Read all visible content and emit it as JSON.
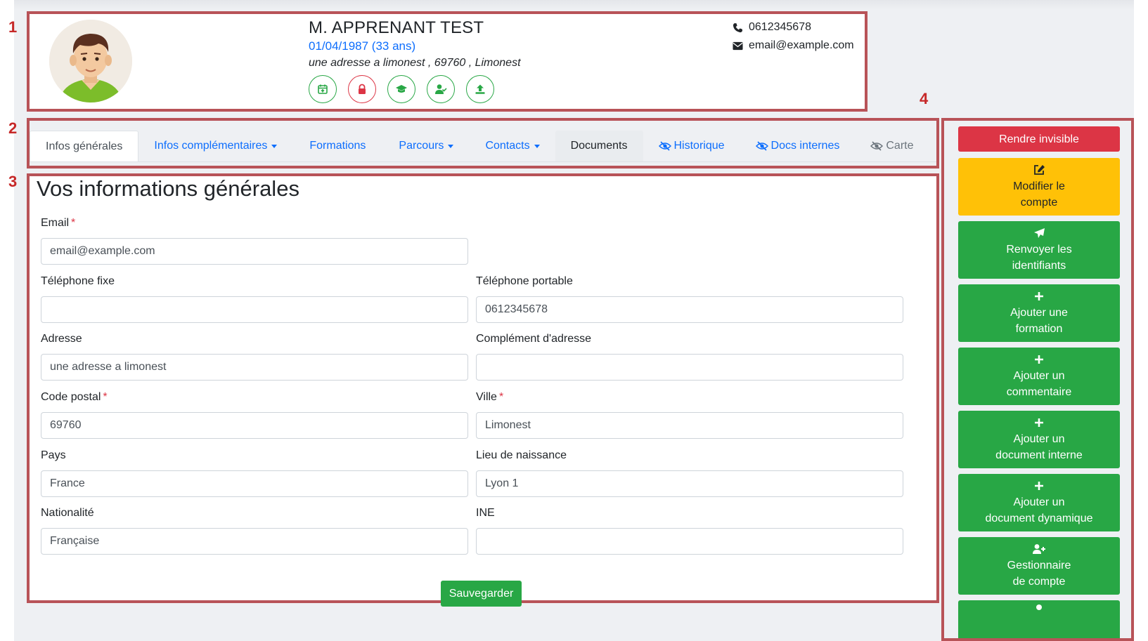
{
  "markers": [
    "1",
    "2",
    "3",
    "4"
  ],
  "header": {
    "name": "M. APPRENANT TEST",
    "dob": "01/04/1987 (33 ans)",
    "address": "une adresse a limonest , 69760 , Limonest",
    "phone": "0612345678",
    "email": "email@example.com",
    "icons": [
      "calendar-plus-icon",
      "lock-icon",
      "graduation-cap-icon",
      "user-check-icon",
      "upload-icon"
    ]
  },
  "tabs": [
    {
      "label": "Infos générales",
      "state": "active"
    },
    {
      "label": "Infos complémentaires",
      "dropdown": true
    },
    {
      "label": "Formations"
    },
    {
      "label": "Parcours",
      "dropdown": true
    },
    {
      "label": "Contacts",
      "dropdown": true
    },
    {
      "label": "Documents",
      "state": "dark"
    },
    {
      "label": "Historique",
      "icon": "eye-slash-icon"
    },
    {
      "label": "Docs internes",
      "icon": "eye-slash-icon"
    },
    {
      "label": "Carte",
      "icon": "eye-slash-icon",
      "state": "gray"
    }
  ],
  "form": {
    "title": "Vos informations générales",
    "fields": {
      "email": {
        "label": "Email",
        "value": "email@example.com",
        "required": true
      },
      "tel_fixe": {
        "label": "Téléphone fixe",
        "value": ""
      },
      "tel_portable": {
        "label": "Téléphone portable",
        "value": "0612345678"
      },
      "adresse": {
        "label": "Adresse",
        "value": "une adresse a limonest"
      },
      "complement": {
        "label": "Complément d'adresse",
        "value": ""
      },
      "code_postal": {
        "label": "Code postal",
        "value": "69760",
        "required": true
      },
      "ville": {
        "label": "Ville",
        "value": "Limonest",
        "required": true
      },
      "pays": {
        "label": "Pays",
        "value": "France"
      },
      "lieu_naissance": {
        "label": "Lieu de naissance",
        "value": "Lyon 1"
      },
      "nationalite": {
        "label": "Nationalité",
        "value": "Française"
      },
      "ine": {
        "label": "INE",
        "value": ""
      }
    },
    "save_label": "Sauvegarder"
  },
  "sidebar": {
    "buttons": [
      {
        "line1": "Rendre invisible",
        "line2": "",
        "icon": ""
      },
      {
        "line1": "Modifier le",
        "line2": "compte",
        "icon": "edit-icon"
      },
      {
        "line1": "Renvoyer les",
        "line2": "identifiants",
        "icon": "paper-plane-icon"
      },
      {
        "line1": "Ajouter une",
        "line2": "formation",
        "icon": "plus-icon"
      },
      {
        "line1": "Ajouter un",
        "line2": "commentaire",
        "icon": "plus-icon"
      },
      {
        "line1": "Ajouter un",
        "line2": "document interne",
        "icon": "plus-icon"
      },
      {
        "line1": "Ajouter un",
        "line2": "document dynamique",
        "icon": "plus-icon"
      },
      {
        "line1": "Gestionnaire",
        "line2": "de compte",
        "icon": "user-plus-icon"
      }
    ]
  },
  "colors": {
    "annotation": "#b85358",
    "primary": "#0d6efd",
    "success": "#28a745",
    "danger": "#dc3545",
    "warning": "#ffc107"
  }
}
